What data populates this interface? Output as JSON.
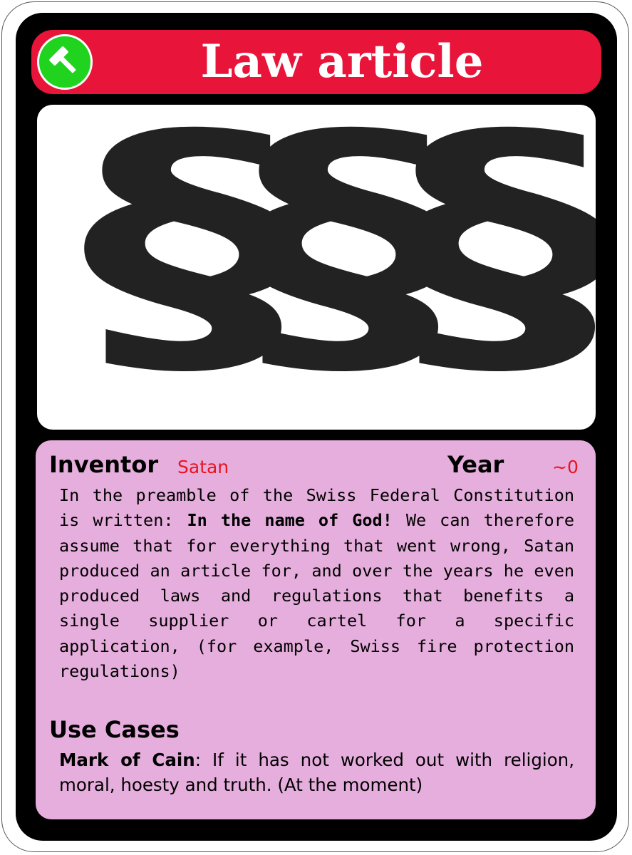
{
  "card": {
    "title": "Law article",
    "category_icon": "hammer-icon",
    "picture_glyphs": "§§§",
    "colors": {
      "header": "#e8143a",
      "icon_badge": "#1fd31f",
      "info_panel": "#e6aedd",
      "accent_text": "#e8141e"
    }
  },
  "stats": {
    "inventor_label": "Inventor",
    "inventor_value": "Satan",
    "year_label": "Year",
    "year_value": "~0"
  },
  "description": {
    "text_before": "In the preamble of the Swiss Federal Constitution is written: ",
    "text_bold": "In the name of God!",
    "text_after": " We can therefore assume that for everything that went wrong, Satan produced an article for, and over the years he even produced laws and regulations that benefits a single supplier or cartel for a specific application, (for example, Swiss fire protection regulations)"
  },
  "use_cases": {
    "heading": "Use Cases",
    "item_name": "Mark of Cain",
    "item_text": ": If it has not worked out with religion, moral, hoesty and truth. (At the moment)"
  }
}
